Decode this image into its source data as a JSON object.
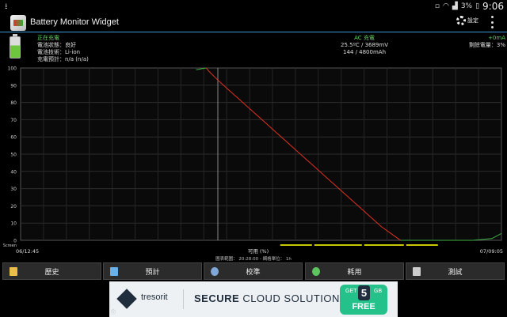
{
  "status_bar": {
    "battery_percent": "3%",
    "time": "9:06"
  },
  "app": {
    "title": "Battery Monitor Widget",
    "settings_label": "設定"
  },
  "info": {
    "status": "正在充電",
    "health": "電池狀態：良好",
    "technology": "電池技術：Li-ion",
    "estimate": "充電預計：n/a (n/a)",
    "charge_type": "AC 充電",
    "temp_voltage": "25.5ºC / 3689mV",
    "capacity": "144 / 4800mAh",
    "current": "+0mA",
    "remaining": "剩餘電量：3%",
    "battery_level": 0.03
  },
  "chart_data": {
    "type": "line",
    "y_ticks": [
      "100",
      "90",
      "80",
      "70",
      "60",
      "50",
      "40",
      "30",
      "20",
      "10",
      "0"
    ],
    "ylim": [
      0,
      100
    ],
    "screen_label": "Screen",
    "x_start": "06/12:45",
    "x_end": "07/09:05",
    "x_label": "可用 (%)",
    "footer": "圖表範圍： 20:28:00 - 網格單位： 1h",
    "grid": true,
    "series": [
      {
        "color": "#e03020",
        "points": [
          [
            0.386,
            100
          ],
          [
            0.392,
            98
          ],
          [
            0.41,
            93
          ],
          [
            0.43,
            88
          ],
          [
            0.45,
            83
          ],
          [
            0.47,
            78
          ],
          [
            0.49,
            73
          ],
          [
            0.51,
            68
          ],
          [
            0.53,
            63
          ],
          [
            0.55,
            58
          ],
          [
            0.57,
            53
          ],
          [
            0.59,
            48
          ],
          [
            0.61,
            43
          ],
          [
            0.63,
            38
          ],
          [
            0.65,
            33
          ],
          [
            0.67,
            28
          ],
          [
            0.69,
            23
          ],
          [
            0.71,
            18
          ],
          [
            0.73,
            13
          ],
          [
            0.75,
            8
          ],
          [
            0.77,
            4
          ],
          [
            0.785,
            1
          ],
          [
            0.79,
            0
          ]
        ]
      },
      {
        "color": "#3cb043",
        "points": [
          [
            0.365,
            99
          ],
          [
            0.375,
            99.5
          ],
          [
            0.386,
            100
          ]
        ]
      },
      {
        "color": "#3cb043",
        "points": [
          [
            0.79,
            0
          ],
          [
            0.86,
            0
          ],
          [
            0.94,
            0
          ],
          [
            0.98,
            1
          ],
          [
            1.0,
            4
          ]
        ]
      }
    ]
  },
  "buttons": [
    {
      "label": "歷史",
      "icon": "book-icon",
      "color": "#e8c048"
    },
    {
      "label": "預計",
      "icon": "chart-icon",
      "color": "#6ab0e8"
    },
    {
      "label": "校準",
      "icon": "gauge-icon",
      "color": "#7fa8d8"
    },
    {
      "label": "耗用",
      "icon": "globe-icon",
      "color": "#5ec45e"
    },
    {
      "label": "測試",
      "icon": "android-icon",
      "color": "#cccccc"
    }
  ],
  "ad": {
    "brand": "tresorit",
    "slogan_bold": "SECURE",
    "slogan_rest": "CLOUD SOLUTION",
    "get": "GET",
    "amount": "5",
    "unit": "GB",
    "free": "FREE"
  }
}
